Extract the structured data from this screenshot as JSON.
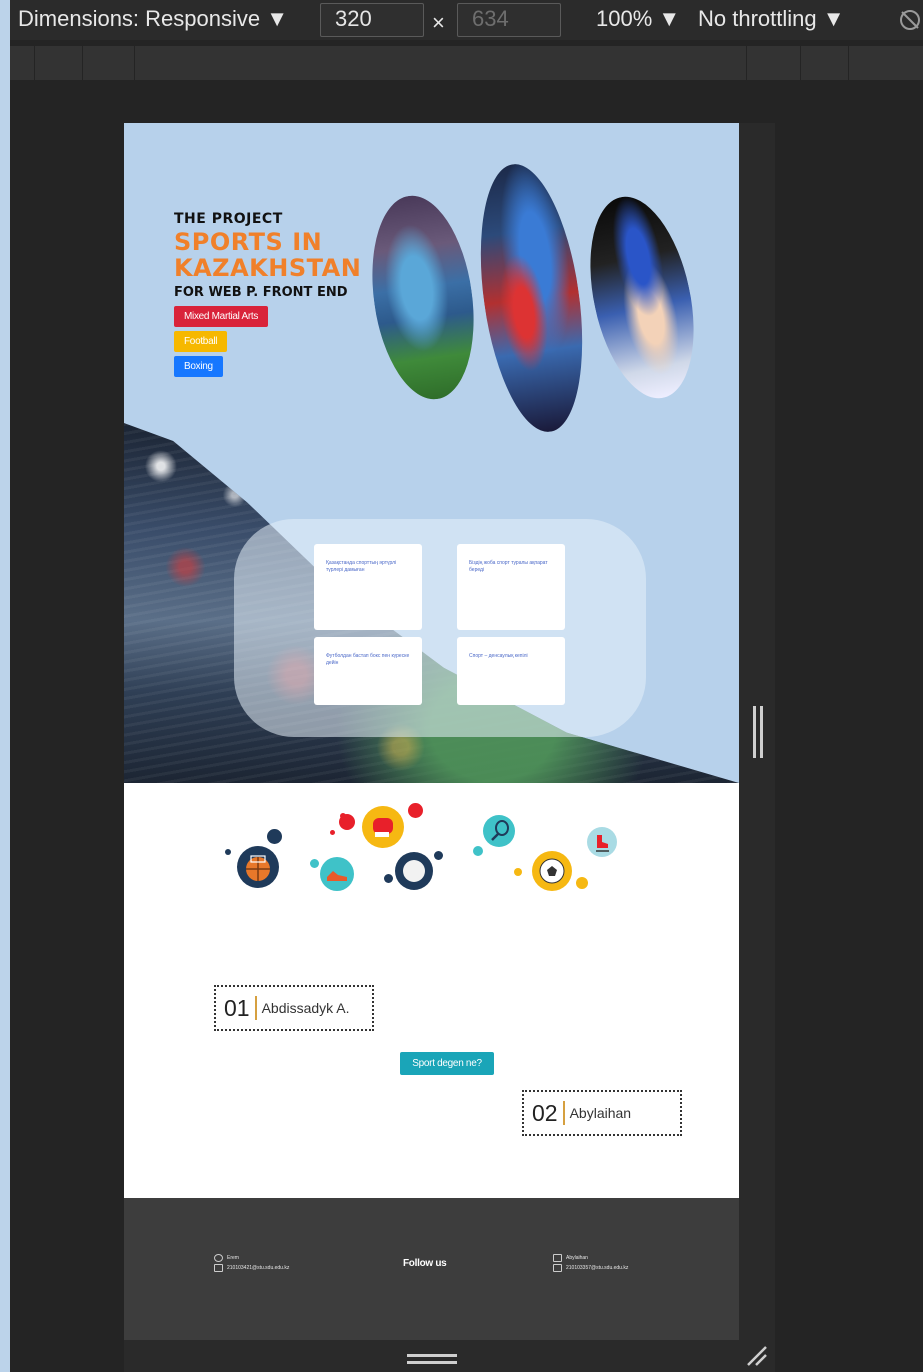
{
  "toolbar": {
    "dimensions_label": "Dimensions: Responsive ▼",
    "width_value": "320",
    "times": "×",
    "height_value": "634",
    "zoom": "100% ▼",
    "throttling": "No throttling ▼",
    "rotate_icon": "rotate-icon"
  },
  "hero": {
    "eyebrow": "THE PROJECT",
    "title": "SPORTS IN KAZAKHSTAN",
    "subtitle": "FOR WEB P. FRONT END",
    "tags": [
      {
        "label": "Mixed Martial Arts",
        "color": "#d9233a"
      },
      {
        "label": "Football",
        "color": "#f6b800"
      },
      {
        "label": "Boxing",
        "color": "#1677ff"
      }
    ],
    "photos": [
      "football-player-photo",
      "mma-fighter-photo",
      "boxer-photo"
    ]
  },
  "cards": [
    "Қазақстанда спорттың әртүрлі түрлері дамыған",
    "Біздің жоба спорт туралы ақпарат береді",
    "Футболдан бастап бокс пен күреске дейін",
    "Спорт – денсаулық кепілі"
  ],
  "icons": [
    "basketball-icon",
    "boxing-glove-icon",
    "sneaker-icon",
    "bowling-ball-icon",
    "tennis-racket-icon",
    "soccer-ball-icon",
    "ice-skate-icon"
  ],
  "names": [
    {
      "num": "01",
      "name": "Abdissadyk A."
    },
    {
      "num": "02",
      "name": "Abylaihan"
    }
  ],
  "cta_label": "Sport degen ne?",
  "footer": {
    "left_name": "Erem",
    "left_email": "210103421@stu.sdu.edu.kz",
    "follow": "Follow us",
    "right_name": "Abylaihan",
    "right_email": "210103357@stu.sdu.edu.kz"
  },
  "colors": {
    "accent_orange": "#f0802a",
    "hero_bg": "#b7d1eb",
    "cta": "#1aa5b8",
    "footer_bg": "#3d3d3d"
  }
}
